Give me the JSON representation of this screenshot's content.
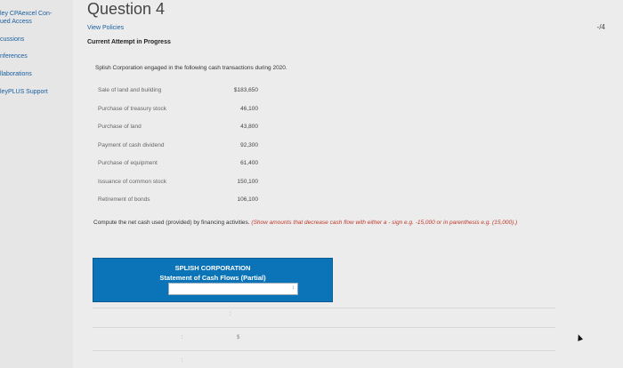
{
  "sidebar": {
    "items": [
      {
        "label": "ley CPAexcel Con-"
      },
      {
        "label": "ued Access"
      },
      {
        "label": "cussions"
      },
      {
        "label": "nferences"
      },
      {
        "label": "llaborations"
      },
      {
        "label": "leyPLUS Support"
      }
    ]
  },
  "question": {
    "title": "Question 4",
    "score": "-/4",
    "view_policies": "View Policies",
    "attempt": "Current Attempt in Progress",
    "intro": "Splish Corporation engaged in the following cash transactions during 2020."
  },
  "transactions": [
    {
      "label": "Sale of land and building",
      "value": "$183,650"
    },
    {
      "label": "Purchase of treasury stock",
      "value": "46,100"
    },
    {
      "label": "Purchase of land",
      "value": "43,800"
    },
    {
      "label": "Payment of cash dividend",
      "value": "92,300"
    },
    {
      "label": "Purchase of equipment",
      "value": "61,400"
    },
    {
      "label": "Issuance of common stock",
      "value": "150,100"
    },
    {
      "label": "Retirement of bonds",
      "value": "106,100"
    }
  ],
  "instructions": {
    "text": "Compute the net cash used (provided) by financing activities.",
    "note": "(Show amounts that decrease cash flow with either a - sign e.g. -15,000 or in parenthesis e.g. (15,000).)"
  },
  "statement": {
    "company": "SPLISH CORPORATION",
    "subtitle": "Statement of Cash Flows (Partial)",
    "select_arrow": "↕",
    "marks": [
      ":",
      ":",
      "$",
      ":"
    ]
  }
}
